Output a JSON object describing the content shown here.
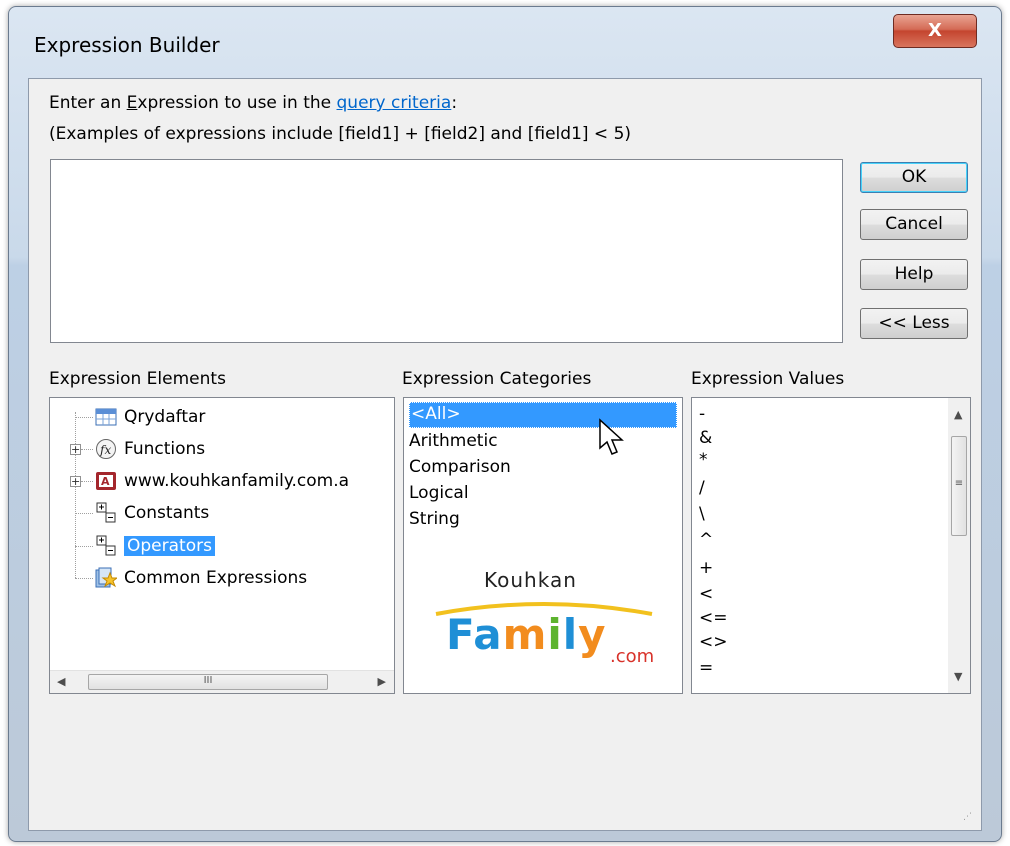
{
  "window": {
    "title": "Expression Builder",
    "close_label": "X"
  },
  "prompt": {
    "line1_prefix_1": "Enter an ",
    "line1_underlined": "E",
    "line1_prefix_2": "xpression to use in the ",
    "line1_link": "query criteria",
    "line1_suffix": ":",
    "line2": "(Examples of expressions include [field1] + [field2] and [field1] < 5)"
  },
  "expression_input": {
    "value": ""
  },
  "buttons": {
    "ok": "OK",
    "cancel": "Cancel",
    "help": "Help",
    "less": "<< Less"
  },
  "panels": {
    "elements": {
      "label": "Expression Elements",
      "items": [
        {
          "label": "Qrydaftar",
          "icon": "query-icon"
        },
        {
          "label": "Functions",
          "icon": "function-icon"
        },
        {
          "label": "www.kouhkanfamily.com.a",
          "icon": "database-icon"
        },
        {
          "label": "Constants",
          "icon": "constants-icon"
        },
        {
          "label": "Operators",
          "icon": "operators-icon",
          "selected": true
        },
        {
          "label": "Common Expressions",
          "icon": "common-expressions-icon"
        }
      ],
      "hscroll_thumb": "III"
    },
    "categories": {
      "label": "Expression Categories",
      "items": [
        "<All>",
        "Arithmetic",
        "Comparison",
        "Logical",
        "String"
      ],
      "selected_index": 0
    },
    "values": {
      "label": "Expression Values",
      "items": [
        "-",
        "&",
        "*",
        "/",
        "\\",
        "^",
        "+",
        "<",
        "<=",
        "<>",
        "="
      ],
      "vscroll_thumb": "≡"
    }
  },
  "watermark": {
    "top": "Kouhkan",
    "main": "Family",
    "suffix": ".com"
  },
  "colors": {
    "selection": "#3399ff",
    "link": "#0066cc",
    "logo_orange": "#f28c1e",
    "logo_blue": "#1f8fd6",
    "logo_green": "#5db42f"
  }
}
